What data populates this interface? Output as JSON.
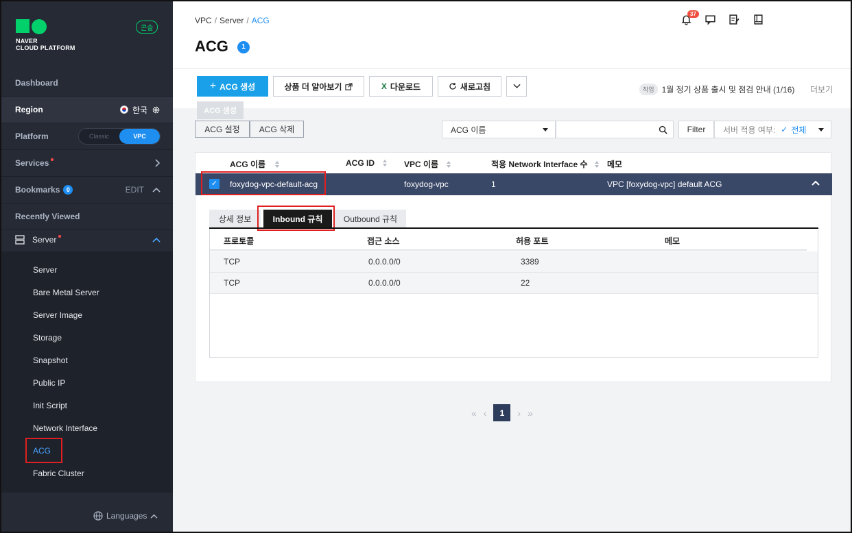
{
  "brand": {
    "logo_line1": "NAVER",
    "logo_line2": "CLOUD PLATFORM",
    "console_badge": "콘솔",
    "brand_color": "#02d16b"
  },
  "sidebar": {
    "dashboard": "Dashboard",
    "region": {
      "label": "Region",
      "value": "한국"
    },
    "platform": {
      "label": "Platform",
      "options": [
        "Classic",
        "VPC"
      ],
      "selected": "VPC"
    },
    "services": "Services",
    "bookmarks": {
      "label": "Bookmarks",
      "count": "0",
      "edit": "EDIT"
    },
    "recently_viewed": "Recently Viewed",
    "server_group": "Server",
    "items": [
      {
        "label": "Server"
      },
      {
        "label": "Bare Metal Server"
      },
      {
        "label": "Server Image"
      },
      {
        "label": "Storage"
      },
      {
        "label": "Snapshot"
      },
      {
        "label": "Public IP"
      },
      {
        "label": "Init Script"
      },
      {
        "label": "Network Interface"
      },
      {
        "label": "ACG",
        "active": true
      },
      {
        "label": "Fabric Cluster"
      }
    ],
    "languages": "Languages"
  },
  "header": {
    "breadcrumb": [
      "VPC",
      "Server",
      "ACG"
    ],
    "title": "ACG",
    "title_count": "1",
    "notification_count": "37"
  },
  "toolbar": {
    "create": "ACG 생성",
    "learn_more": "상품 더 알아보기",
    "download": "다운로드",
    "refresh": "새로고침",
    "notice_tag": "작업",
    "notice_text": "1월 정기 상품 출시 및 점검 안내 (1/16)",
    "more": "더보기",
    "tooltip": "ACG 생성"
  },
  "filter": {
    "acg_settings": "ACG 설정",
    "acg_delete": "ACG 삭제",
    "search_field": "ACG 이름",
    "search_value": "",
    "filter_label": "Filter",
    "server_applied_label": "서버 적용 여부:",
    "server_applied_value": "전체"
  },
  "table": {
    "columns": [
      "ACG 이름",
      "ACG ID",
      "VPC 이름",
      "적용 Network Interface 수",
      "메모"
    ],
    "row": {
      "name": "foxydog-vpc-default-acg",
      "id": "",
      "vpc": "foxydog-vpc",
      "ni_count": "1",
      "memo": "VPC [foxydog-vpc] default ACG"
    }
  },
  "detail": {
    "tabs": [
      "상세 정보",
      "Inbound 규칙",
      "Outbound 규칙"
    ],
    "active_tab": "Inbound 규칙",
    "rule_columns": [
      "프로토콜",
      "접근 소스",
      "허용 포트",
      "메모"
    ],
    "rules": [
      {
        "protocol": "TCP",
        "source": "0.0.0.0/0",
        "port": "3389",
        "memo": ""
      },
      {
        "protocol": "TCP",
        "source": "0.0.0.0/0",
        "port": "22",
        "memo": ""
      }
    ]
  },
  "pagination": {
    "current": "1"
  },
  "colors": {
    "accent": "#1f8ef1",
    "primary_button": "#1aa0e8",
    "selected_row": "#3a4868",
    "highlight_box": "#e02020"
  }
}
